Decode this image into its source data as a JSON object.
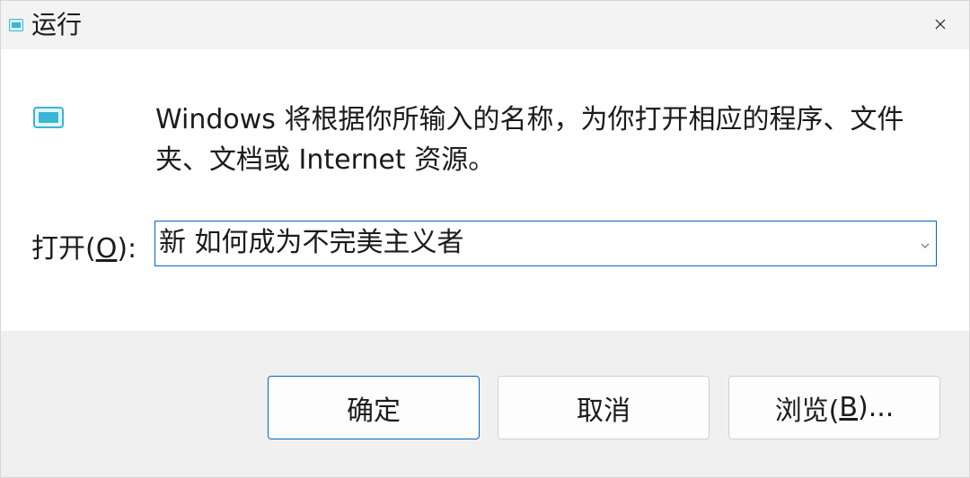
{
  "window": {
    "title": "运行",
    "title_icon": "run-dialog-icon",
    "close_icon": "close-icon"
  },
  "content": {
    "app_icon": "run-app-icon",
    "description": "Windows 将根据你所输入的名称，为你打开相应的程序、文件夹、文档或 Internet 资源。"
  },
  "open_field": {
    "label_prefix": "打开(",
    "label_accel": "O",
    "label_suffix": "):",
    "value": "新 如何成为不完美主义者",
    "dropdown_icon": "chevron-down-icon"
  },
  "buttons": {
    "ok_label": "确定",
    "cancel_label": "取消",
    "browse_prefix": "浏览(",
    "browse_accel": "B",
    "browse_suffix": ")..."
  },
  "colors": {
    "accent": "#0067c0",
    "titlebar_bg": "#f3f3f3",
    "footer_bg": "#f0f0f0",
    "icon_cyan": "#3ab6d6"
  }
}
